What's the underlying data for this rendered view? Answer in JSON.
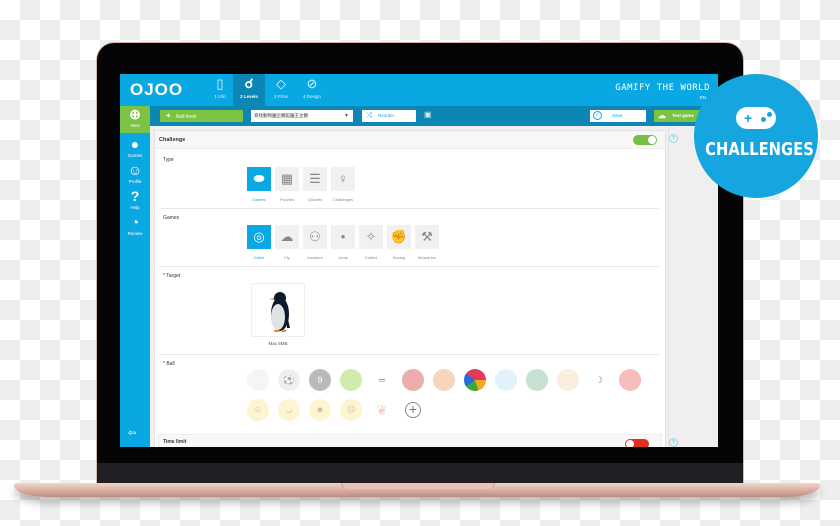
{
  "app": {
    "logo": "OJOO",
    "tagline": "GAMIFY THE WORLD",
    "language": "EN"
  },
  "steps": [
    {
      "label": "1 Info",
      "icon": "book-icon",
      "glyph": "▯",
      "active": false
    },
    {
      "label": "2 Levels",
      "icon": "levels-path-icon",
      "glyph": "☌",
      "active": true
    },
    {
      "label": "3 Prize",
      "icon": "diamond-icon",
      "glyph": "◇",
      "active": false
    },
    {
      "label": "4 Design",
      "icon": "palette-icon",
      "glyph": "⊘",
      "active": false
    }
  ],
  "toolbar": {
    "add_level": "Add level",
    "level_select": "尋找動物園企鵝館園王企鵝",
    "reorder": "Reorder",
    "save": "Save",
    "test_game": "Test game"
  },
  "sidebar": {
    "new": "New",
    "items": [
      {
        "label": "Games",
        "icon": "games-icon",
        "glyph": "●"
      },
      {
        "label": "Profile",
        "icon": "profile-icon",
        "glyph": "☺"
      },
      {
        "label": "Help",
        "icon": "help-icon",
        "glyph": "?"
      },
      {
        "label": "Review",
        "icon": "gauge-icon",
        "glyph": "◔"
      }
    ],
    "logout_icon": "logout-icon"
  },
  "challenge": {
    "title": "Challenge",
    "enabled": true,
    "type": {
      "label": "Type",
      "options": [
        {
          "label": "Games",
          "glyph": "⬬",
          "selected": true
        },
        {
          "label": "Puzzles",
          "glyph": "▦",
          "selected": false
        },
        {
          "label": "Quizzes",
          "glyph": "☰",
          "selected": false
        },
        {
          "label": "Challenges",
          "glyph": "♀",
          "selected": false
        }
      ]
    },
    "games": {
      "label": "Games",
      "options": [
        {
          "label": "Catch",
          "glyph": "◎",
          "selected": true
        },
        {
          "label": "Fly",
          "glyph": "☁",
          "selected": false
        },
        {
          "label": "Invaders",
          "glyph": "⚇",
          "selected": false
        },
        {
          "label": "Jump",
          "glyph": "•",
          "selected": false
        },
        {
          "label": "Collect",
          "glyph": "✧",
          "selected": false
        },
        {
          "label": "Boxing",
          "glyph": "✊",
          "selected": false
        },
        {
          "label": "Whack'em",
          "glyph": "⚒",
          "selected": false
        }
      ]
    },
    "target": {
      "label": "* Target",
      "caption": "Max 5MB",
      "image": "penguin"
    },
    "ball": {
      "label": "* Ball",
      "items": [
        {
          "name": "baseball",
          "color": "#e8e8e8",
          "glyph": "",
          "active": false
        },
        {
          "name": "soccer-ball",
          "color": "#dddddd",
          "glyph": "⚽",
          "active": false
        },
        {
          "name": "eight-ball",
          "color": "#666666",
          "glyph": "9",
          "active": false
        },
        {
          "name": "tennis-ball",
          "color": "#9bd24a",
          "glyph": "",
          "active": false
        },
        {
          "name": "dumbbell",
          "color": "#ffffff",
          "glyph": "═",
          "active": false
        },
        {
          "name": "boxing-glove",
          "color": "#d84a4a",
          "glyph": "",
          "active": false
        },
        {
          "name": "basketball",
          "color": "#e9a46a",
          "glyph": "",
          "active": false
        },
        {
          "name": "beach-ball",
          "color": "#e23a5a",
          "glyph": "",
          "active": true
        },
        {
          "name": "shield-ball",
          "color": "#bfe3f6",
          "glyph": "",
          "active": false
        },
        {
          "name": "green-orb",
          "color": "#7fbf9c",
          "glyph": "",
          "active": false
        },
        {
          "name": "cream-ball",
          "color": "#f5d6bb",
          "glyph": "",
          "active": false
        },
        {
          "name": "banana",
          "color": "#ffffff",
          "glyph": "☽",
          "active": false
        },
        {
          "name": "tomato",
          "color": "#ee6a6a",
          "glyph": "",
          "active": false
        }
      ],
      "emojis": [
        {
          "name": "grin-emoji",
          "glyph": "☺"
        },
        {
          "name": "smile-emoji",
          "glyph": "◡"
        },
        {
          "name": "tongue-emoji",
          "glyph": "☻"
        },
        {
          "name": "sad-emoji",
          "glyph": "☹"
        },
        {
          "name": "leaf",
          "glyph": "❦"
        }
      ]
    },
    "time_limit": {
      "label": "Time limit",
      "enabled": false
    }
  },
  "badge": {
    "label": "CHALLENGES",
    "icon": "gamepad-icon"
  }
}
